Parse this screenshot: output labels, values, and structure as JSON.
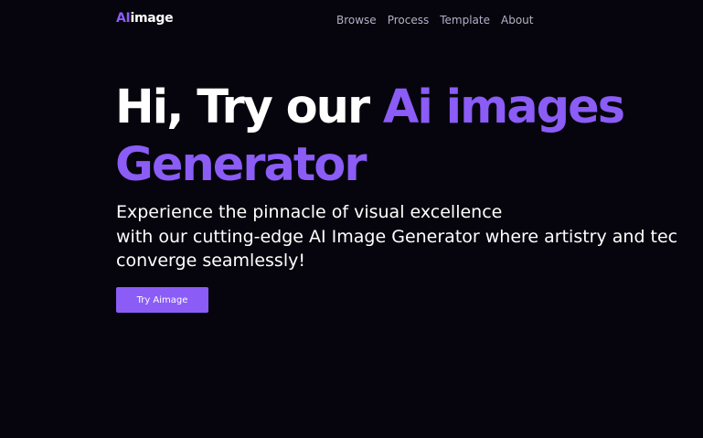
{
  "logo": {
    "accent": "AI",
    "text": "image"
  },
  "nav": {
    "items": [
      {
        "label": "Browse"
      },
      {
        "label": "Process"
      },
      {
        "label": "Template"
      },
      {
        "label": "About"
      }
    ]
  },
  "hero": {
    "headline_white": "Hi, Try our ",
    "headline_accent_1": "Ai images",
    "headline_accent_2": "Generator",
    "subtext_lines": [
      "Experience the pinnacle of visual excellence",
      "with our cutting-edge AI Image Generator where artistry and tec",
      "converge seamlessly!"
    ],
    "cta_label": "Try Aimage"
  },
  "colors": {
    "background": "#06050d",
    "accent": "#8b5cf6",
    "nav_text": "#b3b0c6",
    "text": "#ffffff"
  }
}
